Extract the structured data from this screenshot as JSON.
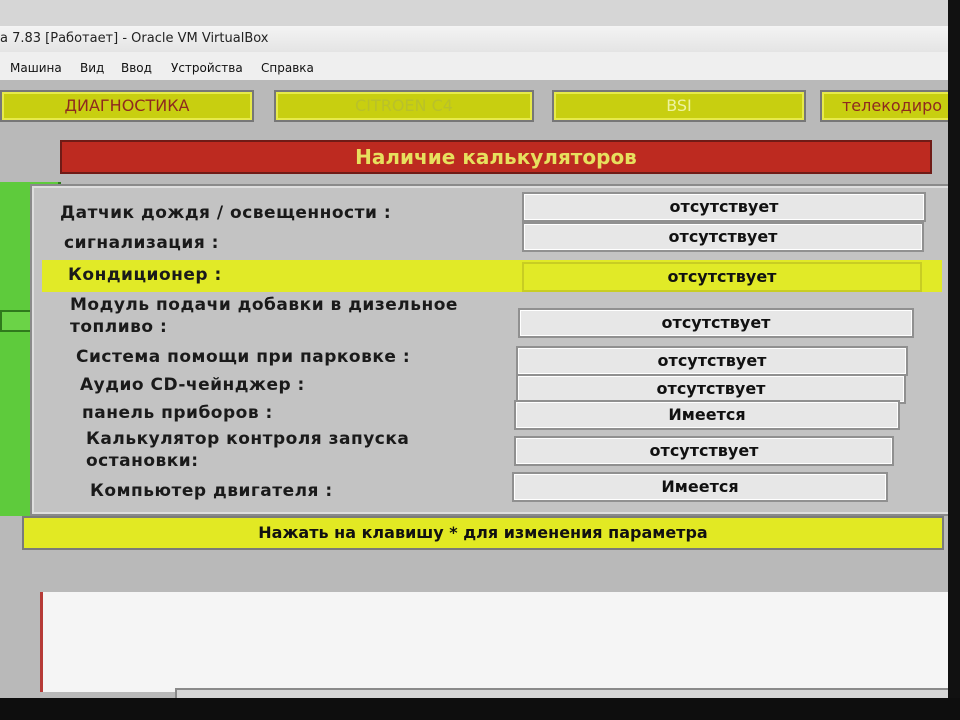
{
  "window": {
    "title": "а 7.83 [Работает] - Oracle VM VirtualBox"
  },
  "menu": {
    "items": [
      "Машина",
      "Вид",
      "Ввод",
      "Устройства",
      "Справка"
    ]
  },
  "tabs": [
    {
      "label": "ДИАГНОСТИКА"
    },
    {
      "label": "CITROEN C4"
    },
    {
      "label": "BSI"
    },
    {
      "label": "телекодиро"
    }
  ],
  "header": {
    "title": "Наличие калькуляторов"
  },
  "rows": [
    {
      "label": "Датчик дождя / освещенности  :",
      "value": "отсутствует"
    },
    {
      "label": "сигнализация  :",
      "value": "отсутствует"
    },
    {
      "label": "Кондиционер  :",
      "value": "отсутствует"
    },
    {
      "label": "Модуль подачи добавки в дизельное топливо  :",
      "value": "отсутствует"
    },
    {
      "label": "Система помощи при парковке  :",
      "value": "отсутствует"
    },
    {
      "label": "Аудио CD-чейнджер  :",
      "value": "отсутствует"
    },
    {
      "label": "панель приборов  :",
      "value": "Имеется"
    },
    {
      "label": "Калькулятор контроля запуска остановки:",
      "value": "отсутствует"
    },
    {
      "label": "Компьютер двигателя  :",
      "value": "Имеется"
    }
  ],
  "footer": {
    "hint": "Нажать на клавишу * для изменения параметра"
  },
  "colors": {
    "accent_yellow": "#e1ea27",
    "header_red": "#bd2a20",
    "side_green": "#5ecb3c"
  }
}
